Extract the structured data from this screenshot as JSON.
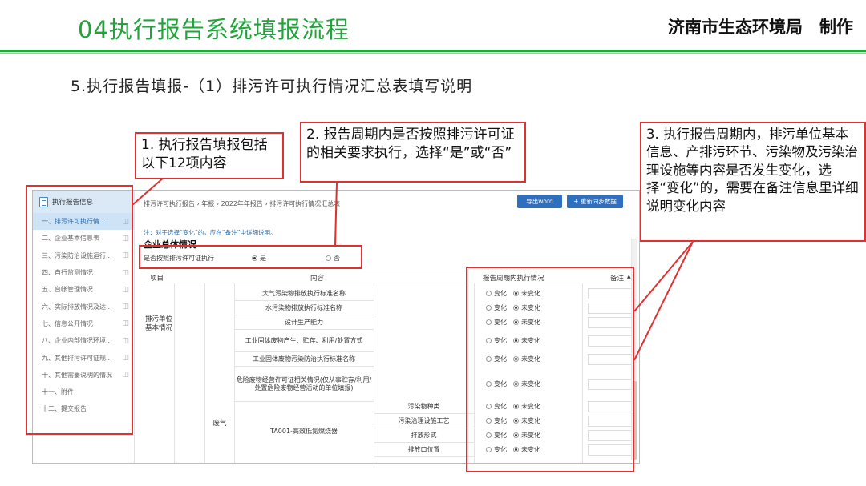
{
  "slide": {
    "title": "04执行报告系统填报流程",
    "brand": "济南市生态环境局　制作",
    "subtitle": "5.执行报告填报-（1）排污许可执行情况汇总表填写说明"
  },
  "callouts": [
    {
      "text": "1. 执行报告填报包括以下12项内容"
    },
    {
      "text": "2. 报告周期内是否按照排污许可证的相关要求执行，选择“是”或“否”"
    },
    {
      "text": "3. 执行报告周期内，排污单位基本信息、产排污环节、污染物及污染治理设施等内容是否发生变化，选择“变化”的，需要在备注信息里详细说明变化内容"
    }
  ],
  "sidebar": {
    "header": "执行报告信息",
    "items": [
      {
        "label": "一、排污许可执行情..."
      },
      {
        "label": "二、企业基本信息表"
      },
      {
        "label": "三、污染防治设施运行..."
      },
      {
        "label": "四、自行监测情况"
      },
      {
        "label": "五、台帐管理情况"
      },
      {
        "label": "六、实际排放情况及达..."
      },
      {
        "label": "七、信息公开情况"
      },
      {
        "label": "八、企业内部情况环境..."
      },
      {
        "label": "九、其他排污许可证规..."
      },
      {
        "label": "十、其他需要说明的情况"
      },
      {
        "label": "十一、附件"
      },
      {
        "label": "十二、提交报告"
      }
    ]
  },
  "main": {
    "breadcrumb": "排污许可执行报告 › 年报 › 2022年年报告 › 排污许可执行情况汇总表",
    "export_label": "导出word",
    "sync_label": "+ 重新同步数据",
    "note": "注：对于选择“变化”的，应在“备注”中详细说明。",
    "section_title": "企业总体情况",
    "question": "是否按照排污许可证执行",
    "yes": "是",
    "no": "否",
    "headers": {
      "item": "项目",
      "content": "内容",
      "status": "报告周期内执行情况",
      "remark": "备注"
    },
    "group1": "排污单位基本情况",
    "group2": "废气",
    "facility": "TA001-高效低氮燃烧器",
    "opt_change": "变化",
    "opt_nochange": "未变化",
    "rows_a": [
      "大气污染物排放执行标准名称",
      "水污染物排放执行标准名称",
      "设计生产能力",
      "工业固体废物产生、贮存、利用/处置方式",
      "工业固体废物污染防治执行标准名称",
      "危险废物经营许可证相关情况(仅从事贮存/利用/处置危险废物经营活动的单位填报)"
    ],
    "rows_b": [
      "污染物种类",
      "污染治理设施工艺",
      "排放形式",
      "排放口位置"
    ]
  },
  "colors": {
    "title_green": "#1fa33a",
    "callout_red": "#e03030",
    "button_blue": "#2f6fbf"
  }
}
